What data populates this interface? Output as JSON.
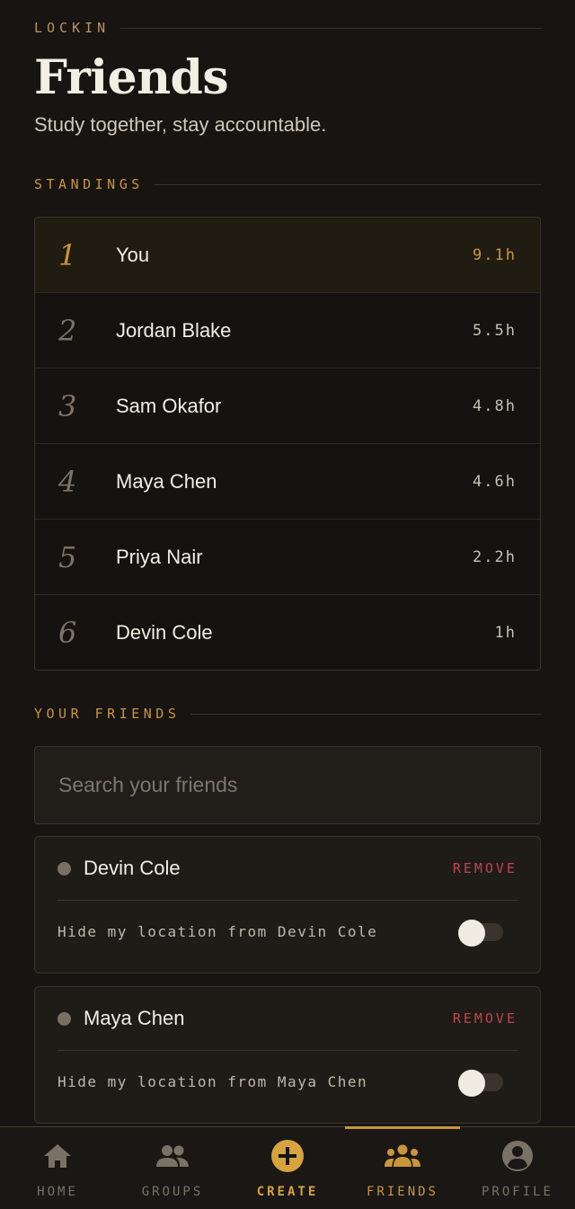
{
  "brand": "LOCKIN",
  "title": "Friends",
  "subtitle": "Study together, stay accountable.",
  "standings": {
    "label": "STANDINGS",
    "rows": [
      {
        "rank": "1",
        "name": "You",
        "hours": "9.1h"
      },
      {
        "rank": "2",
        "name": "Jordan Blake",
        "hours": "5.5h"
      },
      {
        "rank": "3",
        "name": "Sam Okafor",
        "hours": "4.8h"
      },
      {
        "rank": "4",
        "name": "Maya Chen",
        "hours": "4.6h"
      },
      {
        "rank": "5",
        "name": "Priya Nair",
        "hours": "2.2h"
      },
      {
        "rank": "6",
        "name": "Devin Cole",
        "hours": "1h"
      }
    ]
  },
  "friends": {
    "label": "YOUR FRIENDS",
    "search_placeholder": "Search your friends",
    "remove_label": "REMOVE",
    "list": [
      {
        "name": "Devin Cole",
        "hide_text": "Hide my location from Devin Cole"
      },
      {
        "name": "Maya Chen",
        "hide_text": "Hide my location from Maya Chen"
      }
    ]
  },
  "tabs": [
    {
      "label": "HOME",
      "icon": "home-icon"
    },
    {
      "label": "GROUPS",
      "icon": "groups-icon"
    },
    {
      "label": "CREATE",
      "icon": "create-plus-icon"
    },
    {
      "label": "FRIENDS",
      "icon": "friends-icon"
    },
    {
      "label": "PROFILE",
      "icon": "profile-icon"
    }
  ],
  "colors": {
    "accent": "#c9963a",
    "background": "#171411",
    "danger": "#c0444f"
  }
}
